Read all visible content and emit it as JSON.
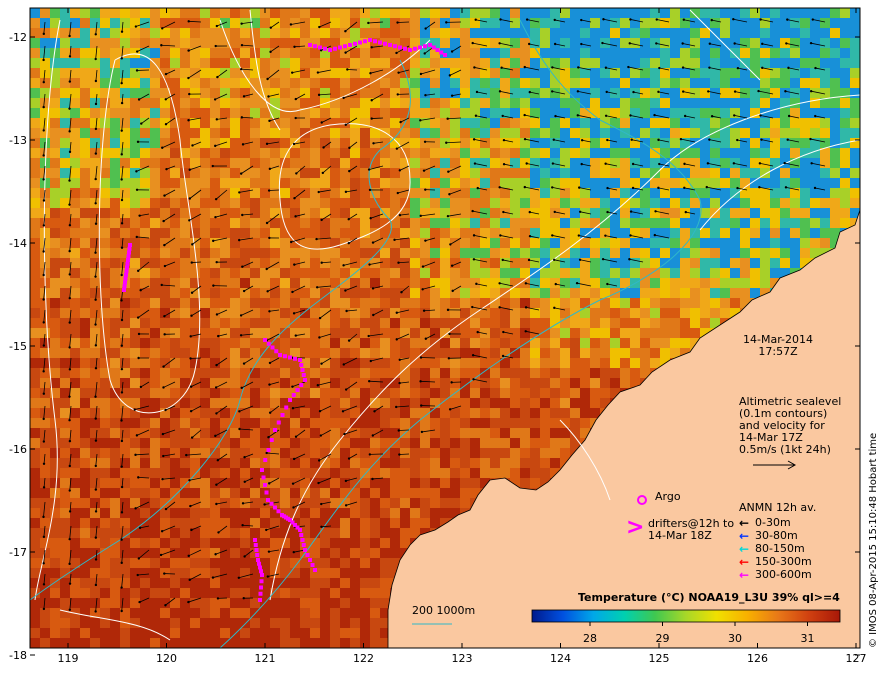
{
  "map": {
    "x_axis": {
      "ticks": [
        "119",
        "120",
        "121",
        "122",
        "123",
        "124",
        "125",
        "126",
        "127"
      ]
    },
    "y_axis": {
      "ticks": [
        "-12",
        "-13",
        "-14",
        "-15",
        "-16",
        "-17",
        "-18"
      ]
    },
    "date_label": "14-Mar-2014",
    "time_label": "17:57Z",
    "altimetry_note": [
      "Altimetric sealevel",
      "(0.1m contours)",
      "and velocity for",
      "14-Mar 17Z",
      "0.5m/s (1kt 24h)"
    ],
    "argo_label": "Argo",
    "drifters_label": [
      "drifters@12h to",
      "14-Mar 18Z"
    ],
    "drifter_symbol": ">",
    "anmn_title": "ANMN 12h av.",
    "anmn_depths": [
      {
        "label": "0-30m",
        "color": "#000000"
      },
      {
        "label": "30-80m",
        "color": "#0033ff"
      },
      {
        "label": "80-150m",
        "color": "#00d8d8"
      },
      {
        "label": "150-300m",
        "color": "#ff0000"
      },
      {
        "label": "300-600m",
        "color": "#ff00ff"
      }
    ],
    "isobath_label": "200  1000m",
    "colorbar": {
      "title": "Temperature (°C) NOAA19_L3U 39% ql>=4",
      "ticks": [
        "28",
        "29",
        "30",
        "31"
      ],
      "colors": [
        "#001a8c",
        "#0050e0",
        "#00a8e8",
        "#00d0b0",
        "#40c850",
        "#a8d828",
        "#f0e000",
        "#f8b000",
        "#e87818",
        "#d04010",
        "#a81808"
      ]
    },
    "credit": "© IMOS 08-Apr-2015 15:10:48 Hobart time"
  }
}
